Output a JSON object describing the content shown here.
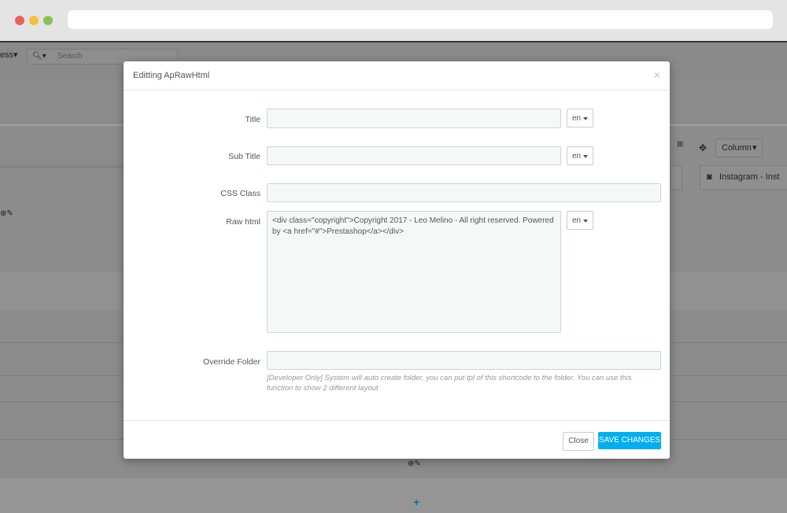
{
  "background": {
    "menu_label": "ess",
    "search_placeholder": "Search",
    "column_button": "Column",
    "instagram_label": "Instagram - Inst"
  },
  "modal": {
    "title": "Editting ApRawHtml",
    "close_symbol": "×",
    "fields": {
      "title_label": "Title",
      "title_value": "",
      "title_lang": "en",
      "subtitle_label": "Sub Title",
      "subtitle_value": "",
      "subtitle_lang": "en",
      "css_class_label": "CSS Class",
      "css_class_value": "",
      "raw_html_label": "Raw html",
      "raw_html_value": "<div class=\"copyright\">Copyright 2017 - Leo Melino - All right reserved. Powered by <a href=\"#\">Prestashop</a></div>",
      "raw_html_lang": "en",
      "override_folder_label": "Override Folder",
      "override_folder_value": "",
      "override_help": "[Developer Only] System will auto create folder, you can put tpl of this shortcode to the folder. You can use this function to show 2 different layout"
    },
    "footer": {
      "close_label": "Close",
      "save_label": "SAVE CHANGES"
    }
  },
  "colors": {
    "accent": "#00aff0",
    "input_bg": "#f5f8f9",
    "overlay": "#8c8c8c"
  }
}
